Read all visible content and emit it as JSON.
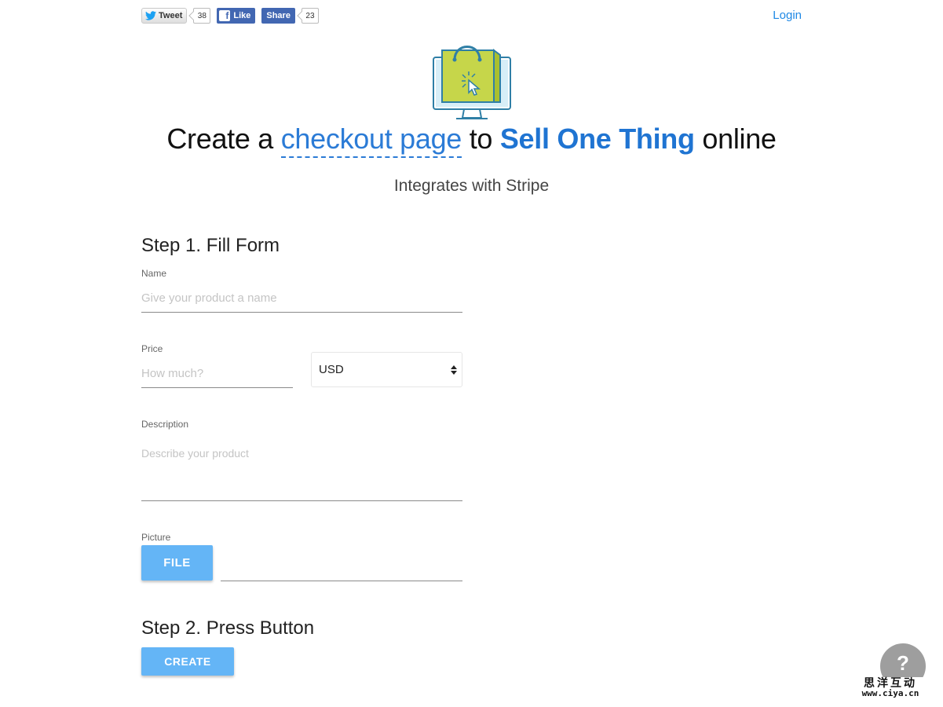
{
  "social": {
    "tweet_label": "Tweet",
    "tweet_count": "38",
    "like_label": "Like",
    "share_label": "Share",
    "share_count": "23"
  },
  "header": {
    "login_label": "Login"
  },
  "hero": {
    "icon": "shopping-bag-monitor-icon",
    "title_part1": "Create a ",
    "title_link": "checkout page",
    "title_part2": " to ",
    "title_bold": "Sell One Thing",
    "title_part3": " online",
    "subtitle": "Integrates with Stripe"
  },
  "step1": {
    "title": "Step 1. Fill Form",
    "name_label": "Name",
    "name_placeholder": "Give your product a name",
    "price_label": "Price",
    "price_placeholder": "How much?",
    "currency_value": "USD",
    "description_label": "Description",
    "description_placeholder": "Describe your product",
    "picture_label": "Picture",
    "file_button": "FILE",
    "file_name_value": ""
  },
  "step2": {
    "title": "Step 2. Press Button",
    "create_button": "CREATE"
  },
  "help": {
    "icon_text": "?"
  },
  "watermark": {
    "text": "思洋互动",
    "url": "www.ciya.cn"
  },
  "colors": {
    "accent_blue": "#1e88e5",
    "button_blue": "#64b5f6",
    "facebook_blue": "#4267b2",
    "bag_green": "#c6d64a"
  }
}
